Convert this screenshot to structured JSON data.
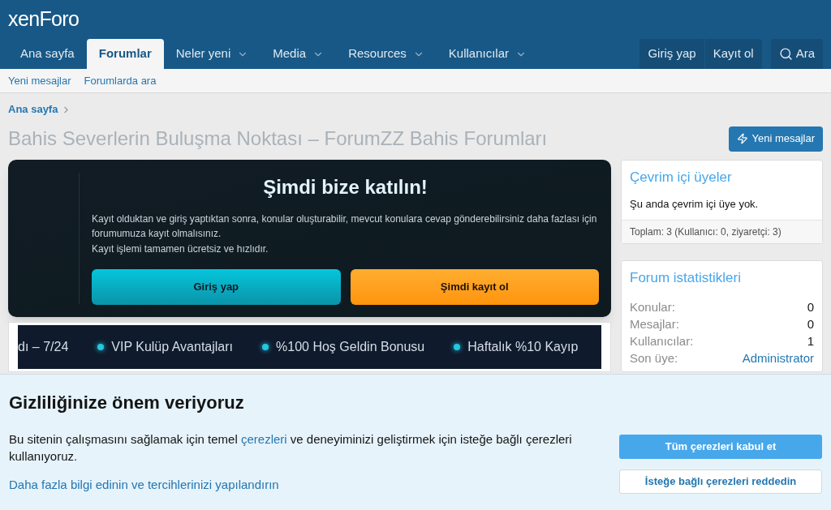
{
  "logo": {
    "text": "xenForo"
  },
  "nav": {
    "tabs": [
      {
        "label": "Ana sayfa",
        "selected": false,
        "dropdown": false
      },
      {
        "label": "Forumlar",
        "selected": true,
        "dropdown": false
      },
      {
        "label": "Neler yeni",
        "selected": false,
        "dropdown": true
      },
      {
        "label": "Media",
        "selected": false,
        "dropdown": true
      },
      {
        "label": "Resources",
        "selected": false,
        "dropdown": true
      },
      {
        "label": "Kullanıcılar",
        "selected": false,
        "dropdown": true
      }
    ],
    "login": "Giriş yap",
    "register": "Kayıt ol",
    "search": "Ara"
  },
  "subnav": [
    "Yeni mesajlar",
    "Forumlarda ara"
  ],
  "breadcrumb": [
    "Ana sayfa"
  ],
  "page_title": "Bahis Severlerin Buluşma Noktası – ForumZZ Bahis Forumları",
  "new_posts_button": "Yeni mesajlar",
  "join_card": {
    "title": "Şimdi bize katılın!",
    "lines": [
      "Kayıt olduktan ve giriş yaptıktan sonra, konular oluşturabilir, mevcut konulara cevap gönderebilirsiniz daha fazlası için forumumuza kayıt olmalısınız.",
      "Kayıt işlemi tamamen ücretsiz ve hızlıdır."
    ],
    "login": "Giriş yap",
    "register": "Şimdi kayıt ol"
  },
  "ticker": [
    {
      "text": "dı – 7/24",
      "dot": false
    },
    {
      "text": "VIP Kulüp Avantajları",
      "dot": true
    },
    {
      "text": "%100 Hoş Geldin Bonusu",
      "dot": true
    },
    {
      "text": "Haftalık %10 Kayıp",
      "dot": true
    }
  ],
  "online": {
    "title": "Çevrim içi üyeler",
    "message": "Şu anda çevrim içi üye yok.",
    "footer": "Toplam: 3 (Kullanıcı: 0, ziyaretçi: 3)"
  },
  "stats": {
    "title": "Forum istatistikleri",
    "rows": [
      {
        "label": "Konular:",
        "value": "0",
        "kind": "text"
      },
      {
        "label": "Mesajlar:",
        "value": "0",
        "kind": "text"
      },
      {
        "label": "Kullanıcılar:",
        "value": "1",
        "kind": "text"
      },
      {
        "label": "Son üye:",
        "value": "Administrator",
        "kind": "link"
      }
    ]
  },
  "cookie": {
    "title": "Gizliliğinize önem veriyoruz",
    "before": "Bu sitenin çalışmasını sağlamak için temel",
    "link": "çerezleri",
    "after": "ve deneyiminizi geliştirmek için isteğe bağlı çerezleri kullanıyoruz.",
    "more": "Daha fazla bilgi edinin ve tercihlerinizi yapılandırın",
    "accept": "Tüm çerezleri kabul et",
    "reject": "İsteğe bağlı çerezleri reddedin"
  }
}
